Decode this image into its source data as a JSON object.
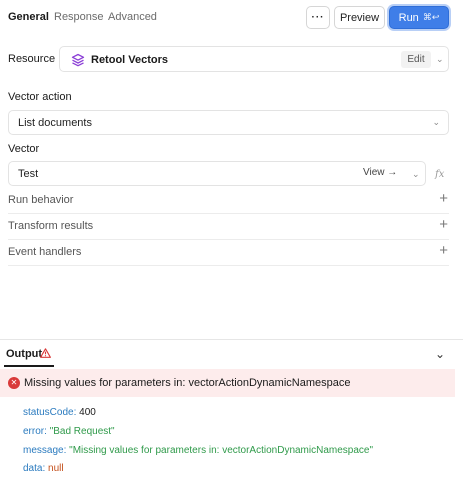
{
  "tabs": [
    {
      "label": "General",
      "active": true
    },
    {
      "label": "Response",
      "active": false
    },
    {
      "label": "Advanced",
      "active": false
    }
  ],
  "toolbar": {
    "more_label": "···",
    "preview_label": "Preview",
    "run_label": "Run",
    "run_shortcut": "⌘↩",
    "run_color": "#3f7ee8"
  },
  "resource": {
    "label": "Resource",
    "name": "Retool Vectors",
    "icon": "stack-layers-icon",
    "icon_color": "#8b3fd6",
    "edit_label": "Edit"
  },
  "vector_action": {
    "label": "Vector action",
    "value": "List documents"
  },
  "vector": {
    "label": "Vector",
    "value": "Test",
    "view_label": "View →",
    "fx_label": "fx"
  },
  "sections": [
    {
      "label": "Run behavior"
    },
    {
      "label": "Transform results"
    },
    {
      "label": "Event handlers"
    }
  ],
  "output": {
    "title": "Output",
    "error_message": "Missing values for parameters in: vectorActionDynamicNamespace",
    "error_color": "#d93a3a",
    "fields": [
      {
        "key": "statusCode:",
        "value": "400",
        "kind": "num"
      },
      {
        "key": "error:",
        "value": "\"Bad Request\"",
        "kind": "str"
      },
      {
        "key": "message:",
        "value": "\"Missing values for parameters in: vectorActionDynamicNamespace\"",
        "kind": "str"
      },
      {
        "key": "data:",
        "value": "null",
        "kind": "null"
      }
    ]
  }
}
